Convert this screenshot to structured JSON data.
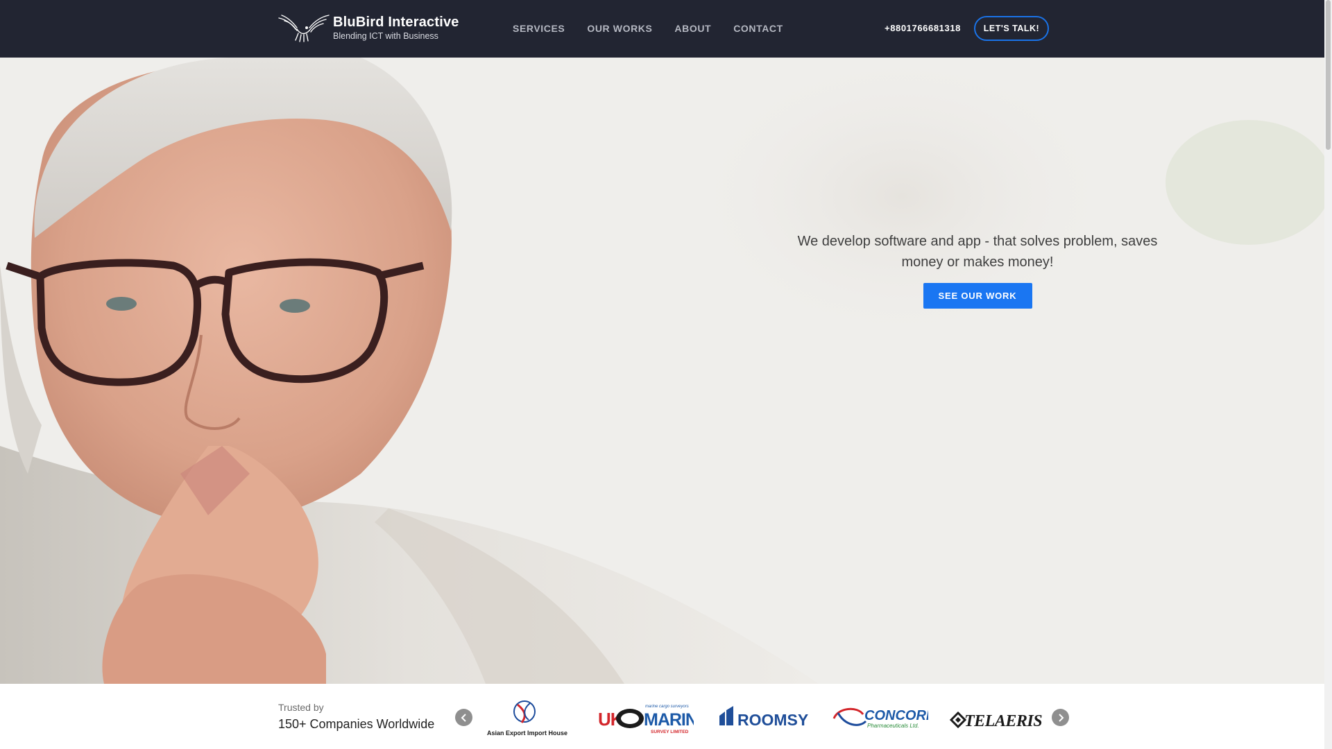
{
  "header": {
    "brand_name": "BluBird Interactive",
    "brand_tagline": "Blending ICT with Business",
    "logo_icon": "bird-wings-icon",
    "nav": [
      {
        "label": "SERVICES"
      },
      {
        "label": "OUR WORKS"
      },
      {
        "label": "ABOUT"
      },
      {
        "label": "CONTACT"
      }
    ],
    "phone": "+8801766681318",
    "cta_label": "LET'S TALK!"
  },
  "hero": {
    "headline": "We develop software and app - that solves problem, saves money or makes money!",
    "button_label": "SEE OUR WORK",
    "image": "man-with-glasses-thinking-photo"
  },
  "trust": {
    "label_small": "Trusted by",
    "label_big": "150+ Companies Worldwide",
    "logos": [
      {
        "name": "Asian Export Import House",
        "icon": "aeih-globe-logo"
      },
      {
        "name": "UK MARINE",
        "subtitle": "marine cargo surveyors",
        "tagline": "SURVEY LIMITED",
        "icon": "uk-marine-logo"
      },
      {
        "name": "ROOMSY",
        "icon": "roomsy-logo"
      },
      {
        "name": "CONCORD",
        "subtitle": "Pharmaceuticals Ltd.",
        "icon": "concord-logo"
      },
      {
        "name": "TELAERIS",
        "icon": "telaeris-logo"
      }
    ],
    "prev_icon": "chevron-left-icon",
    "next_icon": "chevron-right-icon"
  },
  "colors": {
    "header_bg": "#222532",
    "accent": "#1a76f2",
    "cta_border": "#1a73e8"
  }
}
